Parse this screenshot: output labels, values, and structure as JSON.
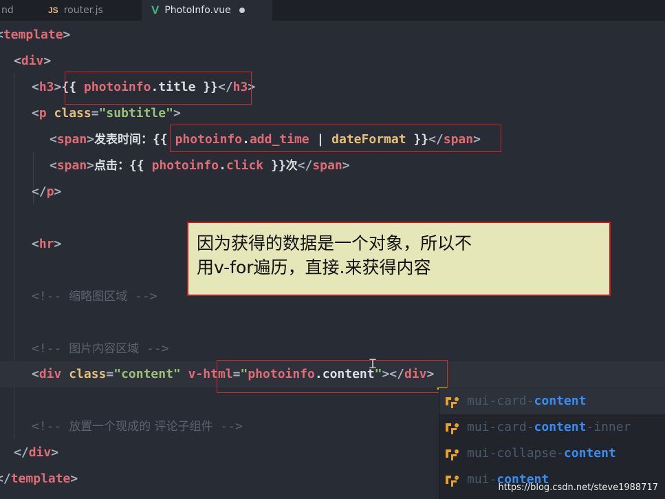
{
  "tabs": [
    {
      "label": "nd"
    },
    {
      "icon": "JS",
      "label": "router.js"
    },
    {
      "icon": "V",
      "label": "PhotoInfo.vue",
      "modified": true
    }
  ],
  "code": {
    "l1": {
      "open": "<",
      "tag": "template",
      "close": ">"
    },
    "l2": {
      "open": "<",
      "tag": "div",
      "close": ">"
    },
    "l3": {
      "open": "<",
      "tag": "h3",
      "close": ">",
      "m1": "{{ ",
      "var": "photoinfo",
      "dot": ".",
      "prop": "title",
      "m2": " }}",
      "etag_open": "</",
      "etag": "h3",
      "etag_close": ">"
    },
    "l4": {
      "open": "<",
      "tag": "p",
      "sp": " ",
      "attr": "class",
      "eq": "=",
      "val": "\"subtitle\"",
      "close": ">"
    },
    "l5": {
      "open": "<",
      "tag": "span",
      "close": ">",
      "label": "发表时间：",
      "m1": "{{ ",
      "var": "photoinfo",
      "dot": ".",
      "prop": "add_time",
      "pipe": " | ",
      "filter": "dateFormat",
      "m2": " }}",
      "etag_open": "</",
      "etag": "span",
      "etag_close": ">"
    },
    "l6": {
      "open": "<",
      "tag": "span",
      "close": ">",
      "label": "点击：",
      "m1": "{{ ",
      "var": "photoinfo",
      "dot": ".",
      "prop": "click",
      "m2": " }}",
      "suffix": "次",
      "etag_open": "</",
      "etag": "span",
      "etag_close": ">"
    },
    "l7": {
      "open": "</",
      "tag": "p",
      "close": ">"
    },
    "l8": {
      "open": "<",
      "tag": "hr",
      "close": ">"
    },
    "l9": {
      "c_open": "<!-- ",
      "text": "缩略图区域",
      "c_close": " -->"
    },
    "l10": {
      "c_open": "<!-- ",
      "text": "图片内容区域",
      "c_close": " -->"
    },
    "l11": {
      "open": "<",
      "tag": "div",
      "sp": " ",
      "attr": "class",
      "eq": "=",
      "val": "\"content\"",
      "sp2": " ",
      "attr2": "v-html",
      "eq2": "=",
      "q1": "\"",
      "var": "photoinfo",
      "dot": ".",
      "prop": "content",
      "q2": "\"",
      "close": ">",
      "etag_open": "</",
      "etag": "div",
      "etag_close": ">"
    },
    "l12": {
      "c_open": "<!-- ",
      "text": "放置一个现成的 评论子组件",
      "c_close": " -->"
    },
    "l13": {
      "open": "</",
      "tag": "div",
      "close": ">"
    },
    "l14": {
      "open": "</",
      "tag": "template",
      "close": ">"
    }
  },
  "callout": {
    "line1": "因为获得的数据是一个对象，所以不",
    "line2": "用v-for遍历，直接.来获得内容"
  },
  "suggestions": [
    {
      "pre": "mui-card-",
      "match": "content",
      "post": "",
      "selected": true
    },
    {
      "pre": "mui-card-",
      "match": "content",
      "post": "-inner",
      "selected": false
    },
    {
      "pre": "mui-collapse-",
      "match": "content",
      "post": "",
      "selected": false
    },
    {
      "pre": "mui-",
      "match": "content",
      "post": "",
      "selected": false
    }
  ],
  "watermark": "https://blog.csdn.net/steve1988717",
  "colors": {
    "background": "#282c34",
    "tag": "#e06c75",
    "attribute": "#e5c07b",
    "string": "#98c379",
    "comment": "#5c6370",
    "highlight_box": "#d12b2b",
    "callout_bg": "#e6e7b9",
    "suggest_match": "#3b8cf0"
  }
}
